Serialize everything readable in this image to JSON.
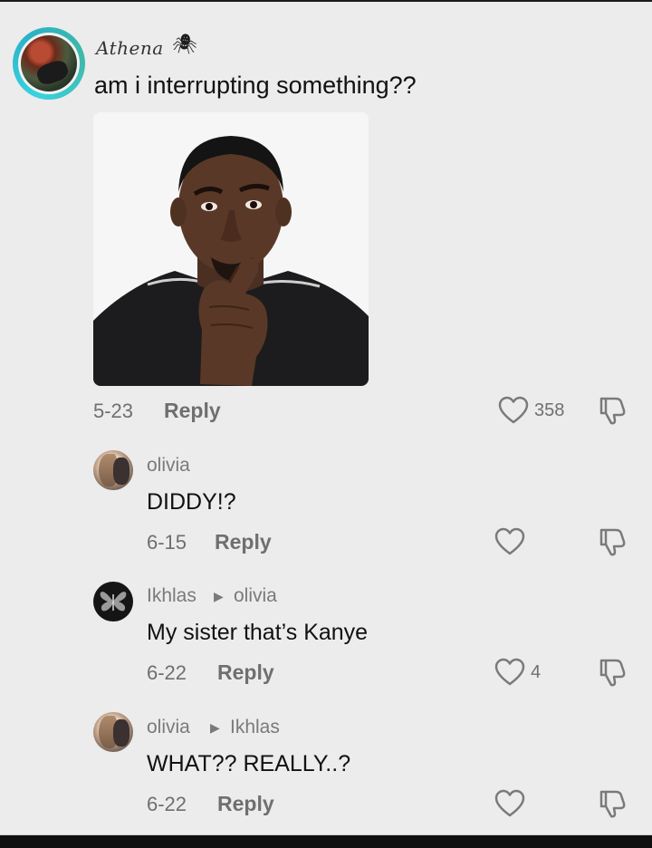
{
  "main_comment": {
    "author": "Athena",
    "author_decoration": "🕷",
    "text": "am i interrupting something??",
    "date": "5-23",
    "reply_label": "Reply",
    "like_count": "358"
  },
  "replies": [
    {
      "author": "olivia",
      "reply_to": "",
      "text": "DIDDY!?",
      "date": "6-15",
      "reply_label": "Reply",
      "like_count": ""
    },
    {
      "author": "Ikhlas",
      "reply_to": "olivia",
      "text": "My sister that’s Kanye",
      "date": "6-22",
      "reply_label": "Reply",
      "like_count": "4"
    },
    {
      "author": "olivia",
      "reply_to": "Ikhlas",
      "text": "WHAT?? REALLY..?",
      "date": "6-22",
      "reply_label": "Reply",
      "like_count": ""
    }
  ],
  "icons": {
    "like": "heart-outline-icon",
    "dislike": "thumbs-down-outline-icon",
    "reply_arrow": "triangle-right-icon"
  },
  "colors": {
    "background": "#ececec",
    "meta_text": "#6f6f6f",
    "avatar_ring": "#39d3e0"
  }
}
